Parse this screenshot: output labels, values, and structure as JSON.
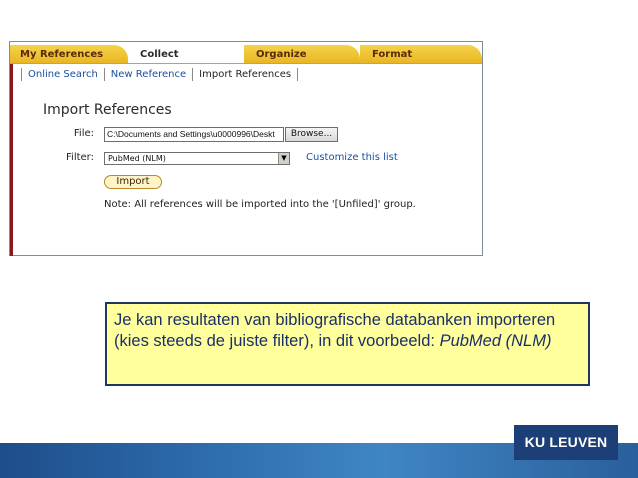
{
  "tabs": [
    "My References",
    "Collect",
    "Organize",
    "Format"
  ],
  "active_tab": "Collect",
  "subnav": {
    "online_search": "Online Search",
    "new_reference": "New Reference",
    "import_references": "Import References"
  },
  "form": {
    "heading": "Import References",
    "file_label": "File:",
    "file_value": "C:\\Documents and Settings\\u0000996\\Deskt",
    "browse_label": "Browse...",
    "filter_label": "Filter:",
    "filter_value": "PubMed (NLM)",
    "customize_link": "Customize this list",
    "import_label": "Import",
    "note": "Note: All references will be imported into the '[Unfiled]' group."
  },
  "callout": {
    "text": "Je kan resultaten van bibliografische databanken importeren (kies steeds de juiste filter), in dit voorbeeld: ",
    "emphasis": "PubMed (NLM)"
  },
  "logo": "KU LEUVEN",
  "colors": {
    "tab_gold": "#e8b422",
    "link_blue": "#1a4fa0",
    "callout_bg": "#ffff9c",
    "callout_text": "#1a2e6a",
    "footer_blue": "#2f6fb0"
  }
}
